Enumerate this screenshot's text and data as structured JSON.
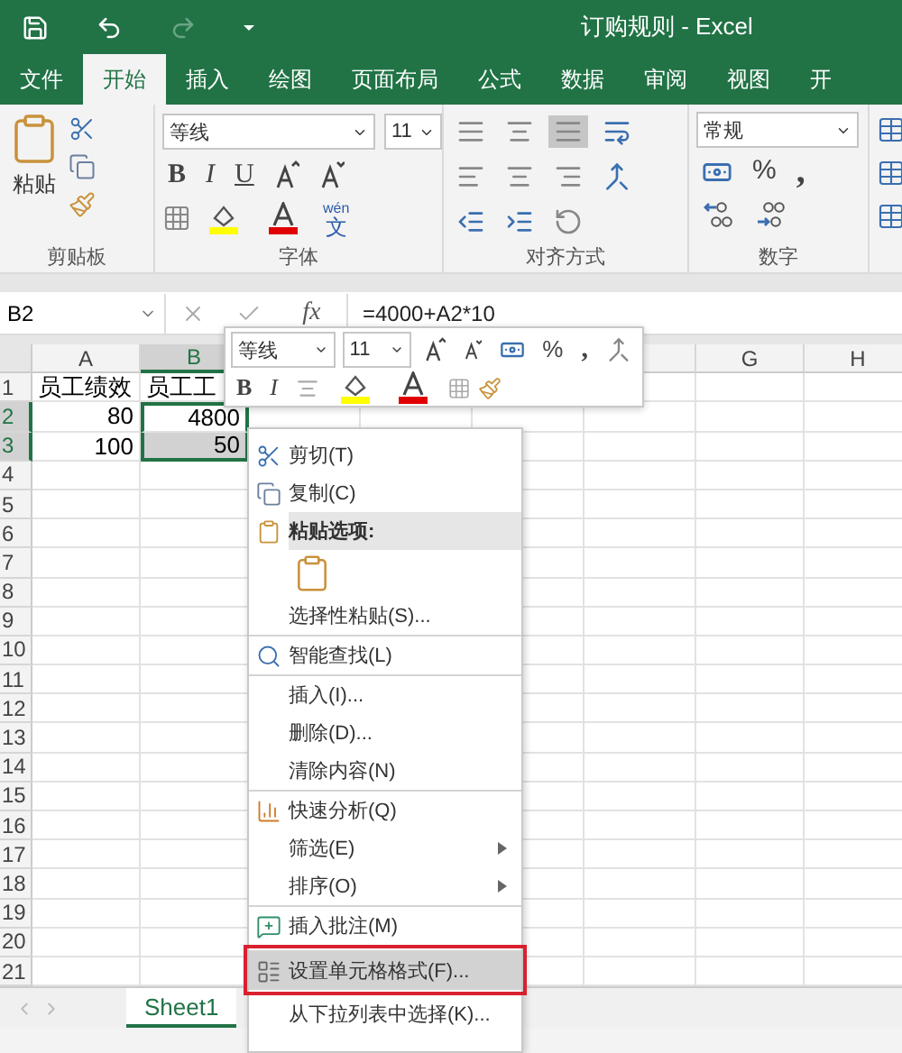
{
  "title_bar": {
    "title": "订购规则 - Excel"
  },
  "ribbon_tabs": [
    {
      "label": "文件",
      "selected": false
    },
    {
      "label": "开始",
      "selected": true
    },
    {
      "label": "插入",
      "selected": false
    },
    {
      "label": "绘图",
      "selected": false
    },
    {
      "label": "页面布局",
      "selected": false
    },
    {
      "label": "公式",
      "selected": false
    },
    {
      "label": "数据",
      "selected": false
    },
    {
      "label": "审阅",
      "selected": false
    },
    {
      "label": "视图",
      "selected": false
    },
    {
      "label": "开",
      "selected": false
    }
  ],
  "ribbon": {
    "clipboard": {
      "paste_label": "粘贴",
      "group_label": "剪贴板"
    },
    "font": {
      "font_name": "等线",
      "font_size": "11",
      "bold": "B",
      "italic": "I",
      "underline": "U",
      "phonetic": "wén",
      "phonetic_char": "文",
      "group_label": "字体"
    },
    "alignment": {
      "group_label": "对齐方式",
      "bottom_align_selected": true
    },
    "number": {
      "format": "常规",
      "percent": "%",
      "comma": ",",
      "group_label": "数字"
    }
  },
  "formula_bar": {
    "name_box": "B2",
    "fx": "fx",
    "formula": "=4000+A2*10"
  },
  "columns": [
    {
      "label": "A",
      "selected": false
    },
    {
      "label": "B",
      "selected": true
    },
    {
      "label": "G",
      "selected": false
    },
    {
      "label": "H",
      "selected": false
    }
  ],
  "rows": [
    {
      "number": "1",
      "selected": false,
      "cells": [
        {
          "text": "员工绩效",
          "numeric": false,
          "selected": false,
          "active": false
        },
        {
          "text": "员工工",
          "numeric": false,
          "selected": false,
          "active": false
        }
      ]
    },
    {
      "number": "2",
      "selected": true,
      "cells": [
        {
          "text": "80",
          "numeric": true,
          "selected": false,
          "active": false
        },
        {
          "text": "4800",
          "numeric": true,
          "selected": true,
          "active": true
        }
      ]
    },
    {
      "number": "3",
      "selected": true,
      "cells": [
        {
          "text": "100",
          "numeric": true,
          "selected": false,
          "active": false
        },
        {
          "text": "50",
          "numeric": true,
          "selected": true,
          "active": false
        }
      ]
    },
    {
      "number": "4",
      "selected": false
    },
    {
      "number": "5",
      "selected": false
    },
    {
      "number": "6",
      "selected": false
    },
    {
      "number": "7",
      "selected": false
    },
    {
      "number": "8",
      "selected": false
    },
    {
      "number": "9",
      "selected": false
    },
    {
      "number": "10",
      "selected": false
    },
    {
      "number": "11",
      "selected": false
    },
    {
      "number": "12",
      "selected": false
    },
    {
      "number": "13",
      "selected": false
    },
    {
      "number": "14",
      "selected": false
    },
    {
      "number": "15",
      "selected": false
    },
    {
      "number": "16",
      "selected": false
    },
    {
      "number": "17",
      "selected": false
    },
    {
      "number": "18",
      "selected": false
    },
    {
      "number": "19",
      "selected": false
    },
    {
      "number": "20",
      "selected": false
    },
    {
      "number": "21",
      "selected": false
    }
  ],
  "mini_toolbar": {
    "font_name": "等线",
    "font_size": "11",
    "bold": "B",
    "italic": "I",
    "percent": "%",
    "comma": ","
  },
  "context_menu": [
    {
      "kind": "command",
      "label": "剪切(T)",
      "submenu": false,
      "selected": false,
      "divider_before": false
    },
    {
      "kind": "command",
      "label": "复制(C)",
      "submenu": false,
      "selected": false,
      "divider_before": false
    },
    {
      "kind": "header",
      "label": "粘贴选项:"
    },
    {
      "kind": "paste-options"
    },
    {
      "kind": "command",
      "label": "选择性粘贴(S)...",
      "submenu": false,
      "selected": false,
      "divider_before": false
    },
    {
      "kind": "command",
      "label": "智能查找(L)",
      "submenu": false,
      "selected": false,
      "divider_before": true
    },
    {
      "kind": "command",
      "label": "插入(I)...",
      "submenu": false,
      "selected": false,
      "divider_before": true
    },
    {
      "kind": "command",
      "label": "删除(D)...",
      "submenu": false,
      "selected": false,
      "divider_before": false
    },
    {
      "kind": "command",
      "label": "清除内容(N)",
      "submenu": false,
      "selected": false,
      "divider_before": false
    },
    {
      "kind": "command",
      "label": "快速分析(Q)",
      "submenu": false,
      "selected": false,
      "divider_before": true
    },
    {
      "kind": "command",
      "label": "筛选(E)",
      "submenu": true,
      "selected": false,
      "divider_before": false
    },
    {
      "kind": "command",
      "label": "排序(O)",
      "submenu": true,
      "selected": false,
      "divider_before": false
    },
    {
      "kind": "command",
      "label": "插入批注(M)",
      "submenu": false,
      "selected": false,
      "divider_before": true
    },
    {
      "kind": "command",
      "label": "设置单元格格式(F)...",
      "submenu": false,
      "selected": true,
      "divider_before": true
    },
    {
      "kind": "command",
      "label": "从下拉列表中选择(K)...",
      "submenu": false,
      "selected": false,
      "divider_before": false
    }
  ],
  "sheet_tabs": [
    {
      "label": "Sheet1",
      "selected": true
    }
  ]
}
